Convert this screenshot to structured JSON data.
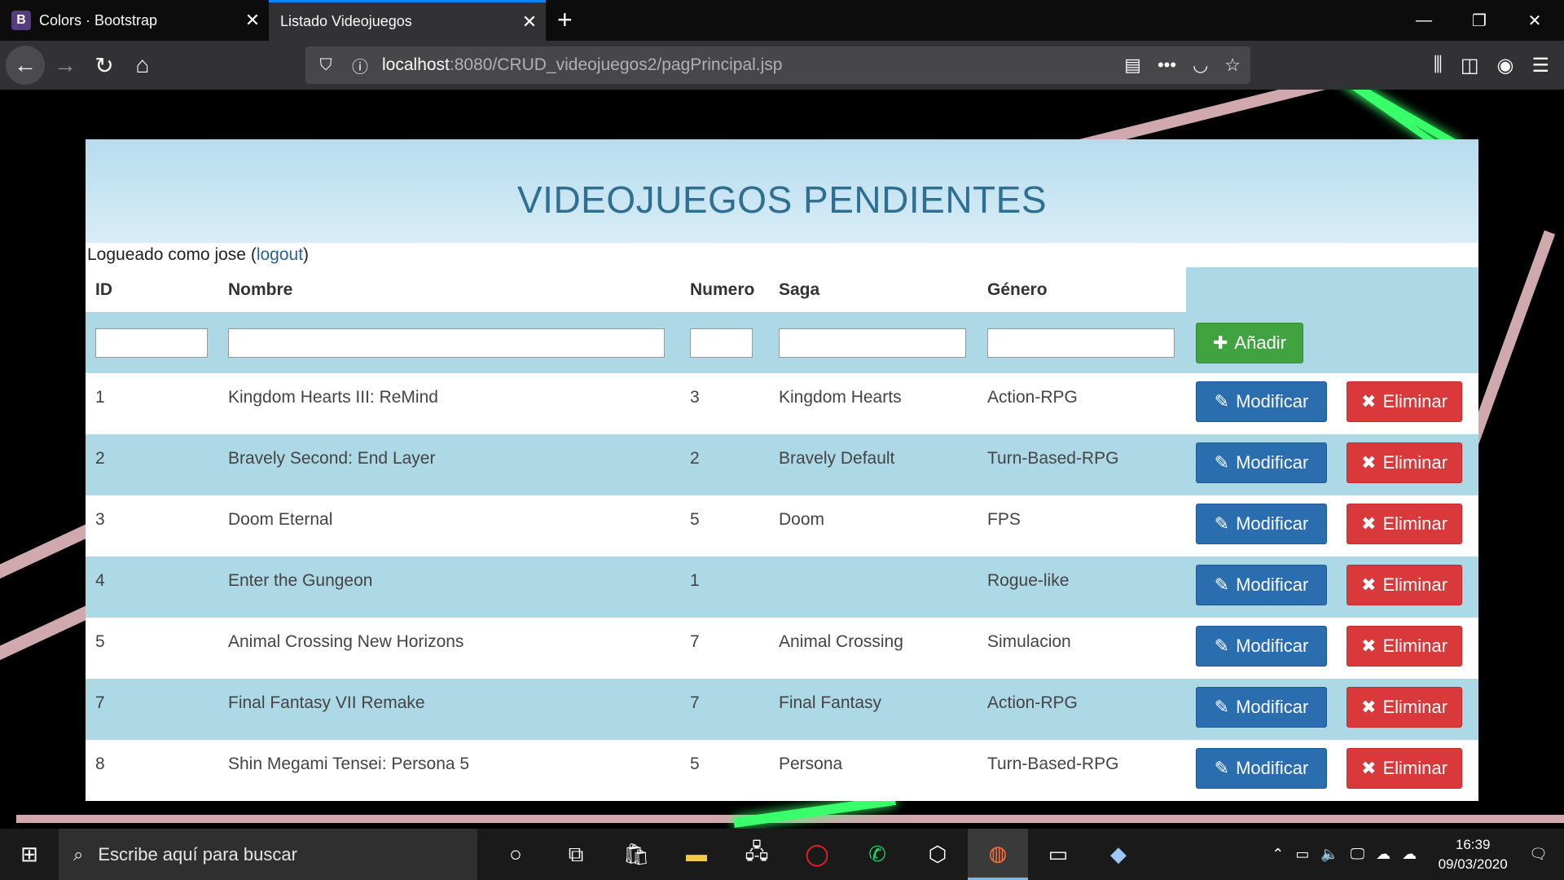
{
  "browser": {
    "tabs": [
      {
        "label": "Colors · Bootstrap",
        "favicon": "B"
      },
      {
        "label": "Listado Videojuegos"
      }
    ],
    "url_host": "localhost",
    "url_path": ":8080/CRUD_videojuegos2/pagPrincipal.jsp"
  },
  "page": {
    "title": "VIDEOJUEGOS PENDIENTES",
    "login_prefix": "Logueado como jose (",
    "logout_label": "logout",
    "login_suffix": ")"
  },
  "table": {
    "headers": [
      "ID",
      "Nombre",
      "Numero",
      "Saga",
      "Género"
    ],
    "add_label": "Añadir",
    "modify_label": "Modificar",
    "delete_label": "Eliminar",
    "rows": [
      {
        "id": "1",
        "nombre": "Kingdom Hearts III: ReMind",
        "numero": "3",
        "saga": "Kingdom Hearts",
        "genero": "Action-RPG"
      },
      {
        "id": "2",
        "nombre": "Bravely Second: End Layer",
        "numero": "2",
        "saga": "Bravely Default",
        "genero": "Turn-Based-RPG"
      },
      {
        "id": "3",
        "nombre": "Doom Eternal",
        "numero": "5",
        "saga": "Doom",
        "genero": "FPS"
      },
      {
        "id": "4",
        "nombre": "Enter the Gungeon",
        "numero": "1",
        "saga": "",
        "genero": "Rogue-like"
      },
      {
        "id": "5",
        "nombre": "Animal Crossing New Horizons",
        "numero": "7",
        "saga": "Animal Crossing",
        "genero": "Simulacion"
      },
      {
        "id": "7",
        "nombre": "Final Fantasy VII Remake",
        "numero": "7",
        "saga": "Final Fantasy",
        "genero": "Action-RPG"
      },
      {
        "id": "8",
        "nombre": "Shin Megami Tensei: Persona 5",
        "numero": "5",
        "saga": "Persona",
        "genero": "Turn-Based-RPG"
      }
    ]
  },
  "taskbar": {
    "search_placeholder": "Escribe aquí para buscar",
    "time": "16:39",
    "date": "09/03/2020"
  },
  "colors": {
    "header_text": "#2f6f92",
    "row_blue": "#add8e6",
    "add_button": "#41a33f",
    "modify_button": "#2a6eb0",
    "delete_button": "#d9393a"
  }
}
